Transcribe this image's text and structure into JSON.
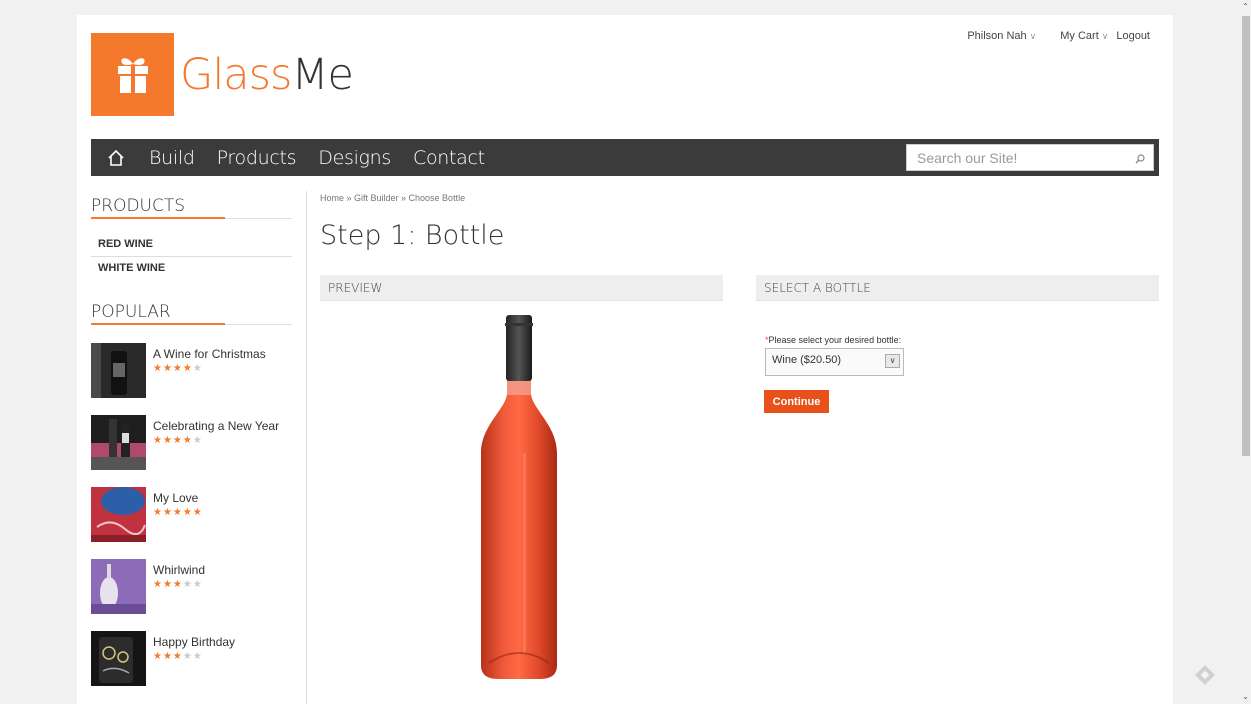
{
  "user": {
    "name": "Philson Nah",
    "cart": "My Cart",
    "logout": "Logout"
  },
  "logo": {
    "part1": "Glass",
    "part2": "Me"
  },
  "nav": {
    "items": [
      "Build",
      "Products",
      "Designs",
      "Contact"
    ]
  },
  "search": {
    "placeholder": "Search our Site!"
  },
  "sidebar": {
    "products_title": "PRODUCTS",
    "categories": [
      "RED WINE",
      "WHITE WINE"
    ],
    "popular_title": "POPULAR",
    "popular": [
      {
        "name": "A Wine for Christmas",
        "rating": 4
      },
      {
        "name": "Celebrating a New Year",
        "rating": 4
      },
      {
        "name": "My Love",
        "rating": 5
      },
      {
        "name": "Whirlwind",
        "rating": 3
      },
      {
        "name": "Happy Birthday",
        "rating": 3
      }
    ]
  },
  "breadcrumb": "Home » Gift Builder » Choose Bottle",
  "page_title": "Step 1: Bottle",
  "preview": {
    "heading": "PREVIEW"
  },
  "select": {
    "heading": "SELECT A BOTTLE",
    "required_mark": "*",
    "label": "Please select your desired bottle:",
    "value": "Wine ($20.50)",
    "button": "Continue"
  },
  "colors": {
    "accent": "#f4792d",
    "nav_bg": "#3b3b3b",
    "button": "#e8521a"
  }
}
